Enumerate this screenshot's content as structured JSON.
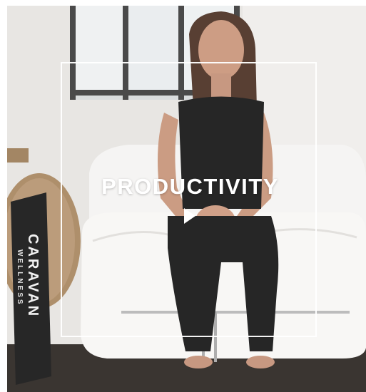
{
  "card": {
    "title": "PRODUCTIVITY",
    "play_icon": "play-icon"
  },
  "roll": {
    "brand": "CARAVAN",
    "sub": "WELLNESS"
  },
  "colors": {
    "overlay_text": "#ffffff",
    "frame": "#ffffff",
    "wall": "#e8e6e3",
    "floor": "#2a2420",
    "outfit": "#141414"
  }
}
